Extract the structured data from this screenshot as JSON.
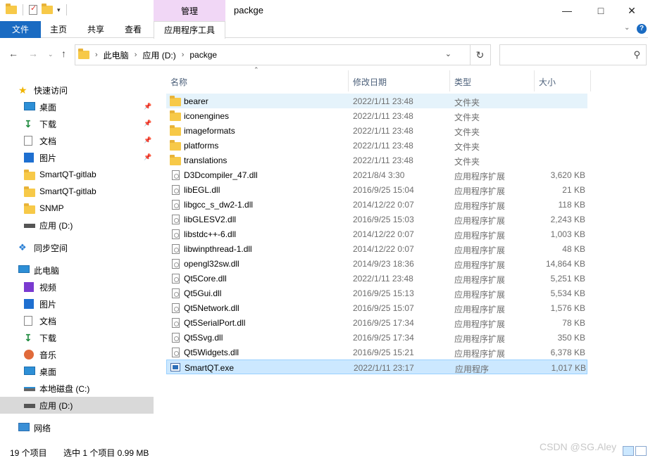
{
  "window": {
    "title": "packge",
    "manage_tab": "管理",
    "min_icon": "minimize-icon",
    "max_icon": "maximize-icon",
    "close_icon": "close-icon"
  },
  "ribbon": {
    "tabs": [
      {
        "label": "文件"
      },
      {
        "label": "主页"
      },
      {
        "label": "共享"
      },
      {
        "label": "查看"
      },
      {
        "label": "应用程序工具"
      }
    ]
  },
  "address": {
    "crumbs": [
      "此电脑",
      "应用 (D:)",
      "packge"
    ],
    "search_placeholder": ""
  },
  "sidebar": {
    "items": [
      {
        "label": "快速访问",
        "icon": "star-icon"
      },
      {
        "label": "桌面",
        "icon": "desktop-icon",
        "pinned": true
      },
      {
        "label": "下载",
        "icon": "download-icon",
        "pinned": true
      },
      {
        "label": "文档",
        "icon": "document-icon",
        "pinned": true
      },
      {
        "label": "图片",
        "icon": "picture-icon",
        "pinned": true
      },
      {
        "label": "SmartQT-gitlab",
        "icon": "folder-icon"
      },
      {
        "label": "SmartQT-gitlab",
        "icon": "folder-icon"
      },
      {
        "label": "SNMP",
        "icon": "folder-icon"
      },
      {
        "label": "应用 (D:)",
        "icon": "drive-icon"
      },
      {
        "label": "同步空间",
        "icon": "sync-icon"
      },
      {
        "label": "此电脑",
        "icon": "computer-icon"
      },
      {
        "label": "视频",
        "icon": "video-icon"
      },
      {
        "label": "图片",
        "icon": "picture-icon"
      },
      {
        "label": "文档",
        "icon": "document-icon"
      },
      {
        "label": "下载",
        "icon": "download-icon"
      },
      {
        "label": "音乐",
        "icon": "music-icon"
      },
      {
        "label": "桌面",
        "icon": "desktop-icon"
      },
      {
        "label": "本地磁盘 (C:)",
        "icon": "local-disk-icon"
      },
      {
        "label": "应用 (D:)",
        "icon": "drive-icon",
        "selected": true
      },
      {
        "label": "网络",
        "icon": "network-icon"
      }
    ]
  },
  "columns": {
    "name": "名称",
    "date": "修改日期",
    "type": "类型",
    "size": "大小"
  },
  "files": [
    {
      "name": "bearer",
      "date": "2022/1/11 23:48",
      "type": "文件夹",
      "size": "",
      "kind": "folder"
    },
    {
      "name": "iconengines",
      "date": "2022/1/11 23:48",
      "type": "文件夹",
      "size": "",
      "kind": "folder"
    },
    {
      "name": "imageformats",
      "date": "2022/1/11 23:48",
      "type": "文件夹",
      "size": "",
      "kind": "folder"
    },
    {
      "name": "platforms",
      "date": "2022/1/11 23:48",
      "type": "文件夹",
      "size": "",
      "kind": "folder"
    },
    {
      "name": "translations",
      "date": "2022/1/11 23:48",
      "type": "文件夹",
      "size": "",
      "kind": "folder"
    },
    {
      "name": "D3Dcompiler_47.dll",
      "date": "2021/8/4 3:30",
      "type": "应用程序扩展",
      "size": "3,620 KB",
      "kind": "dll"
    },
    {
      "name": "libEGL.dll",
      "date": "2016/9/25 15:04",
      "type": "应用程序扩展",
      "size": "21 KB",
      "kind": "dll"
    },
    {
      "name": "libgcc_s_dw2-1.dll",
      "date": "2014/12/22 0:07",
      "type": "应用程序扩展",
      "size": "118 KB",
      "kind": "dll"
    },
    {
      "name": "libGLESV2.dll",
      "date": "2016/9/25 15:03",
      "type": "应用程序扩展",
      "size": "2,243 KB",
      "kind": "dll"
    },
    {
      "name": "libstdc++-6.dll",
      "date": "2014/12/22 0:07",
      "type": "应用程序扩展",
      "size": "1,003 KB",
      "kind": "dll"
    },
    {
      "name": "libwinpthread-1.dll",
      "date": "2014/12/22 0:07",
      "type": "应用程序扩展",
      "size": "48 KB",
      "kind": "dll"
    },
    {
      "name": "opengl32sw.dll",
      "date": "2014/9/23 18:36",
      "type": "应用程序扩展",
      "size": "14,864 KB",
      "kind": "dll"
    },
    {
      "name": "Qt5Core.dll",
      "date": "2022/1/11 23:48",
      "type": "应用程序扩展",
      "size": "5,251 KB",
      "kind": "dll"
    },
    {
      "name": "Qt5Gui.dll",
      "date": "2016/9/25 15:13",
      "type": "应用程序扩展",
      "size": "5,534 KB",
      "kind": "dll"
    },
    {
      "name": "Qt5Network.dll",
      "date": "2016/9/25 15:07",
      "type": "应用程序扩展",
      "size": "1,576 KB",
      "kind": "dll"
    },
    {
      "name": "Qt5SerialPort.dll",
      "date": "2016/9/25 17:34",
      "type": "应用程序扩展",
      "size": "78 KB",
      "kind": "dll"
    },
    {
      "name": "Qt5Svg.dll",
      "date": "2016/9/25 17:34",
      "type": "应用程序扩展",
      "size": "350 KB",
      "kind": "dll"
    },
    {
      "name": "Qt5Widgets.dll",
      "date": "2016/9/25 15:21",
      "type": "应用程序扩展",
      "size": "6,378 KB",
      "kind": "dll"
    },
    {
      "name": "SmartQT.exe",
      "date": "2022/1/11 23:17",
      "type": "应用程序",
      "size": "1,017 KB",
      "kind": "exe",
      "selected": true
    }
  ],
  "status": {
    "count": "19 个项目",
    "selection": "选中 1 个项目  0.99 MB"
  },
  "watermark": "CSDN @SG.Aley",
  "colors": {
    "file_tab": "#1a6bc2",
    "manage_tab": "#f1d7f6",
    "selected_row": "#cce8ff",
    "hover_row": "#e5f3fb",
    "selected_sidebar": "#d9d9d9"
  }
}
